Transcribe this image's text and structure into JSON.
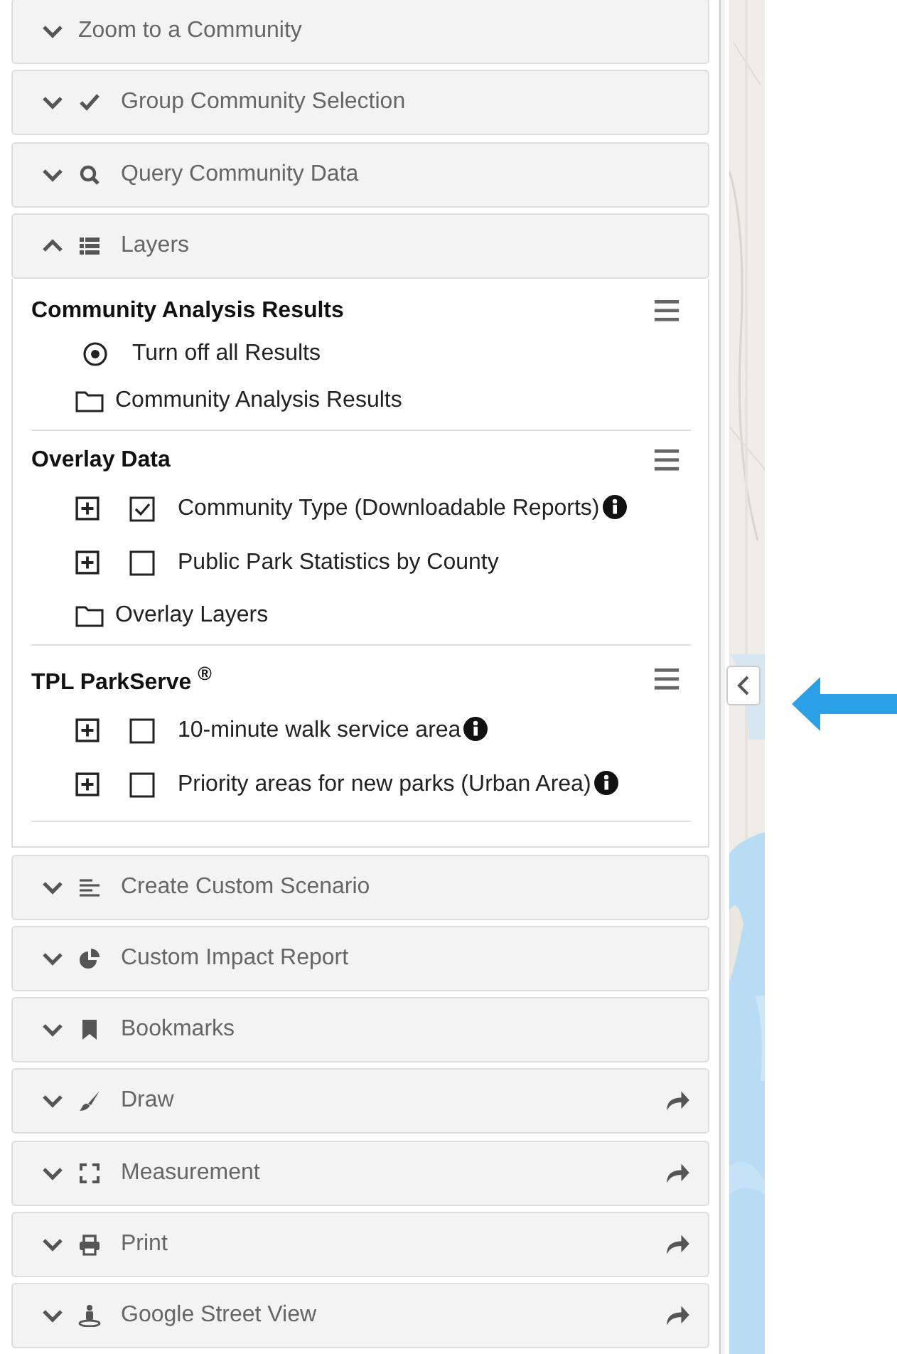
{
  "sections": [
    {
      "title": "Zoom to a Community",
      "expanded": false,
      "popout": false
    },
    {
      "title": "Group Community Selection",
      "expanded": false,
      "popout": false
    },
    {
      "title": "Query Community Data",
      "expanded": false,
      "popout": false
    },
    {
      "title": "Layers",
      "expanded": true,
      "popout": false,
      "groups": [
        {
          "title": "Community Analysis Results",
          "items": [
            {
              "kind": "radio",
              "label": "Turn off all Results",
              "selected": true
            },
            {
              "kind": "folder",
              "label": "Community Analysis Results"
            }
          ]
        },
        {
          "title": "Overlay Data",
          "items": [
            {
              "kind": "layer",
              "label": "Community Type (Downloadable Reports)",
              "checked": true,
              "info": true
            },
            {
              "kind": "layer",
              "label": "Public Park Statistics by County",
              "checked": false,
              "info": false
            },
            {
              "kind": "folder",
              "label": "Overlay Layers"
            }
          ]
        },
        {
          "title": "TPL ParkServe $^{®}$",
          "items": [
            {
              "kind": "layer",
              "label": "10-minute walk service area",
              "checked": false,
              "info": true
            },
            {
              "kind": "layer",
              "label": "Priority areas for new parks (Urban Area)",
              "checked": false,
              "info": true
            }
          ]
        }
      ]
    },
    {
      "title": "Create Custom Scenario",
      "expanded": false,
      "popout": false
    },
    {
      "title": "Custom Impact Report",
      "expanded": false,
      "popout": false
    },
    {
      "title": "Bookmarks",
      "expanded": false,
      "popout": false
    },
    {
      "title": "Draw",
      "expanded": false,
      "popout": true
    },
    {
      "title": "Measurement",
      "expanded": false,
      "popout": true
    },
    {
      "title": "Print",
      "expanded": false,
      "popout": true
    },
    {
      "title": "Google Street View",
      "expanded": false,
      "popout": true
    }
  ]
}
